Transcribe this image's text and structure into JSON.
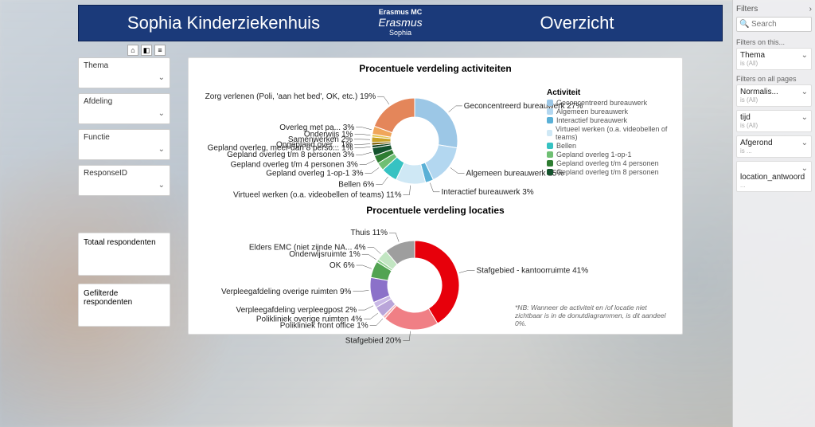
{
  "header": {
    "title_left": "Sophia Kinderziekenhuis",
    "logo_top": "Erasmus MC",
    "logo_script": "Erasmus",
    "logo_sub": "Sophia",
    "title_right": "Overzicht"
  },
  "filters": {
    "thema": "Thema",
    "afdeling": "Afdeling",
    "functie": "Functie",
    "responseid": "ResponseID"
  },
  "cards": {
    "totaal": "Totaal respondenten",
    "gefilterd": "Gefilterde respondenten"
  },
  "chart1": {
    "title": "Procentuele verdeling activiteiten",
    "legend_title": "Activiteit"
  },
  "chart2": {
    "title": "Procentuele verdeling locaties"
  },
  "note": "*NB: Wanneer de activiteit en /of locatie niet zichtbaar is in de donutdiagrammen, is dit aandeel 0%.",
  "filters_pane": {
    "header": "Filters",
    "search_placeholder": "Search",
    "section1": "Filters on this...",
    "section2": "Filters on all pages",
    "items1": [
      {
        "t": "Thema",
        "s": "is (All)"
      }
    ],
    "items2": [
      {
        "t": "Normalis...",
        "s": "is (All)"
      },
      {
        "t": "tijd",
        "s": "is (All)"
      },
      {
        "t": "Afgerond",
        "s": "is ..."
      },
      {
        "t": "location_antwoord",
        "s": "..."
      }
    ]
  },
  "chart_data": [
    {
      "type": "pie",
      "title": "Procentuele verdeling activiteiten",
      "series": [
        {
          "name": "Geconcentreerd bureauwerk",
          "value": 27,
          "color": "#9cc7e6"
        },
        {
          "name": "Algemeen bureauwerk",
          "value": 15,
          "color": "#b3d7f0"
        },
        {
          "name": "Interactief bureauwerk",
          "value": 3,
          "color": "#5ab0d6"
        },
        {
          "name": "Virtueel werken (o.a. videobellen of teams)",
          "value": 11,
          "color": "#cfe8f5"
        },
        {
          "name": "Bellen",
          "value": 6,
          "color": "#36c2c2"
        },
        {
          "name": "Gepland overleg 1-op-1",
          "value": 3,
          "color": "#6fbf73"
        },
        {
          "name": "Gepland overleg t/m 4 personen",
          "value": 3,
          "color": "#2e7d32"
        },
        {
          "name": "Gepland overleg t/m 8 personen",
          "value": 3,
          "color": "#14532d"
        },
        {
          "name": "Gepland overleg, meer dan 8 perso...",
          "value": 1,
          "color": "#0b3d1a"
        },
        {
          "name": "Ongepland over...",
          "value": 1,
          "color": "#7a5c00"
        },
        {
          "name": "Samenwerken",
          "value": 2,
          "color": "#c9a227"
        },
        {
          "name": "Onderwijs",
          "value": 1,
          "color": "#e6c54f"
        },
        {
          "name": "Overleg met pa...",
          "value": 3,
          "color": "#f0a65a"
        },
        {
          "name": "Zorg verlenen (Poli, 'aan het bed', OK, etc.)",
          "value": 19,
          "color": "#e4865a"
        }
      ],
      "legend": [
        "Geconcentreerd bureauwerk",
        "Algemeen bureauwerk",
        "Interactief bureauwerk",
        "Virtueel werken (o.a. videobellen of teams)",
        "Bellen",
        "Gepland overleg 1-op-1",
        "Gepland overleg t/m 4 personen",
        "Gepland overleg t/m 8 personen"
      ]
    },
    {
      "type": "pie",
      "title": "Procentuele verdeling locaties",
      "series": [
        {
          "name": "Stafgebied - kantoorruimte",
          "value": 41,
          "color": "#e7000b"
        },
        {
          "name": "Stafgebied",
          "value": 20,
          "color": "#f07f85"
        },
        {
          "name": "Polikliniek front office",
          "value": 1,
          "color": "#f5b3b7"
        },
        {
          "name": "Polikliniek overige ruimten",
          "value": 4,
          "color": "#b9a5d9"
        },
        {
          "name": "Verpleegafdeling verpleegpost",
          "value": 2,
          "color": "#c9b8e6"
        },
        {
          "name": "Verpleegafdeling overige ruimten",
          "value": 9,
          "color": "#8b71c9"
        },
        {
          "name": "OK",
          "value": 6,
          "color": "#52a352"
        },
        {
          "name": "Onderwijsruimte",
          "value": 1,
          "color": "#8dd08d"
        },
        {
          "name": "Elders EMC (niet zijnde NA...",
          "value": 4,
          "color": "#c2e6c2"
        },
        {
          "name": "Thuis",
          "value": 11,
          "color": "#9e9e9e"
        }
      ]
    }
  ]
}
